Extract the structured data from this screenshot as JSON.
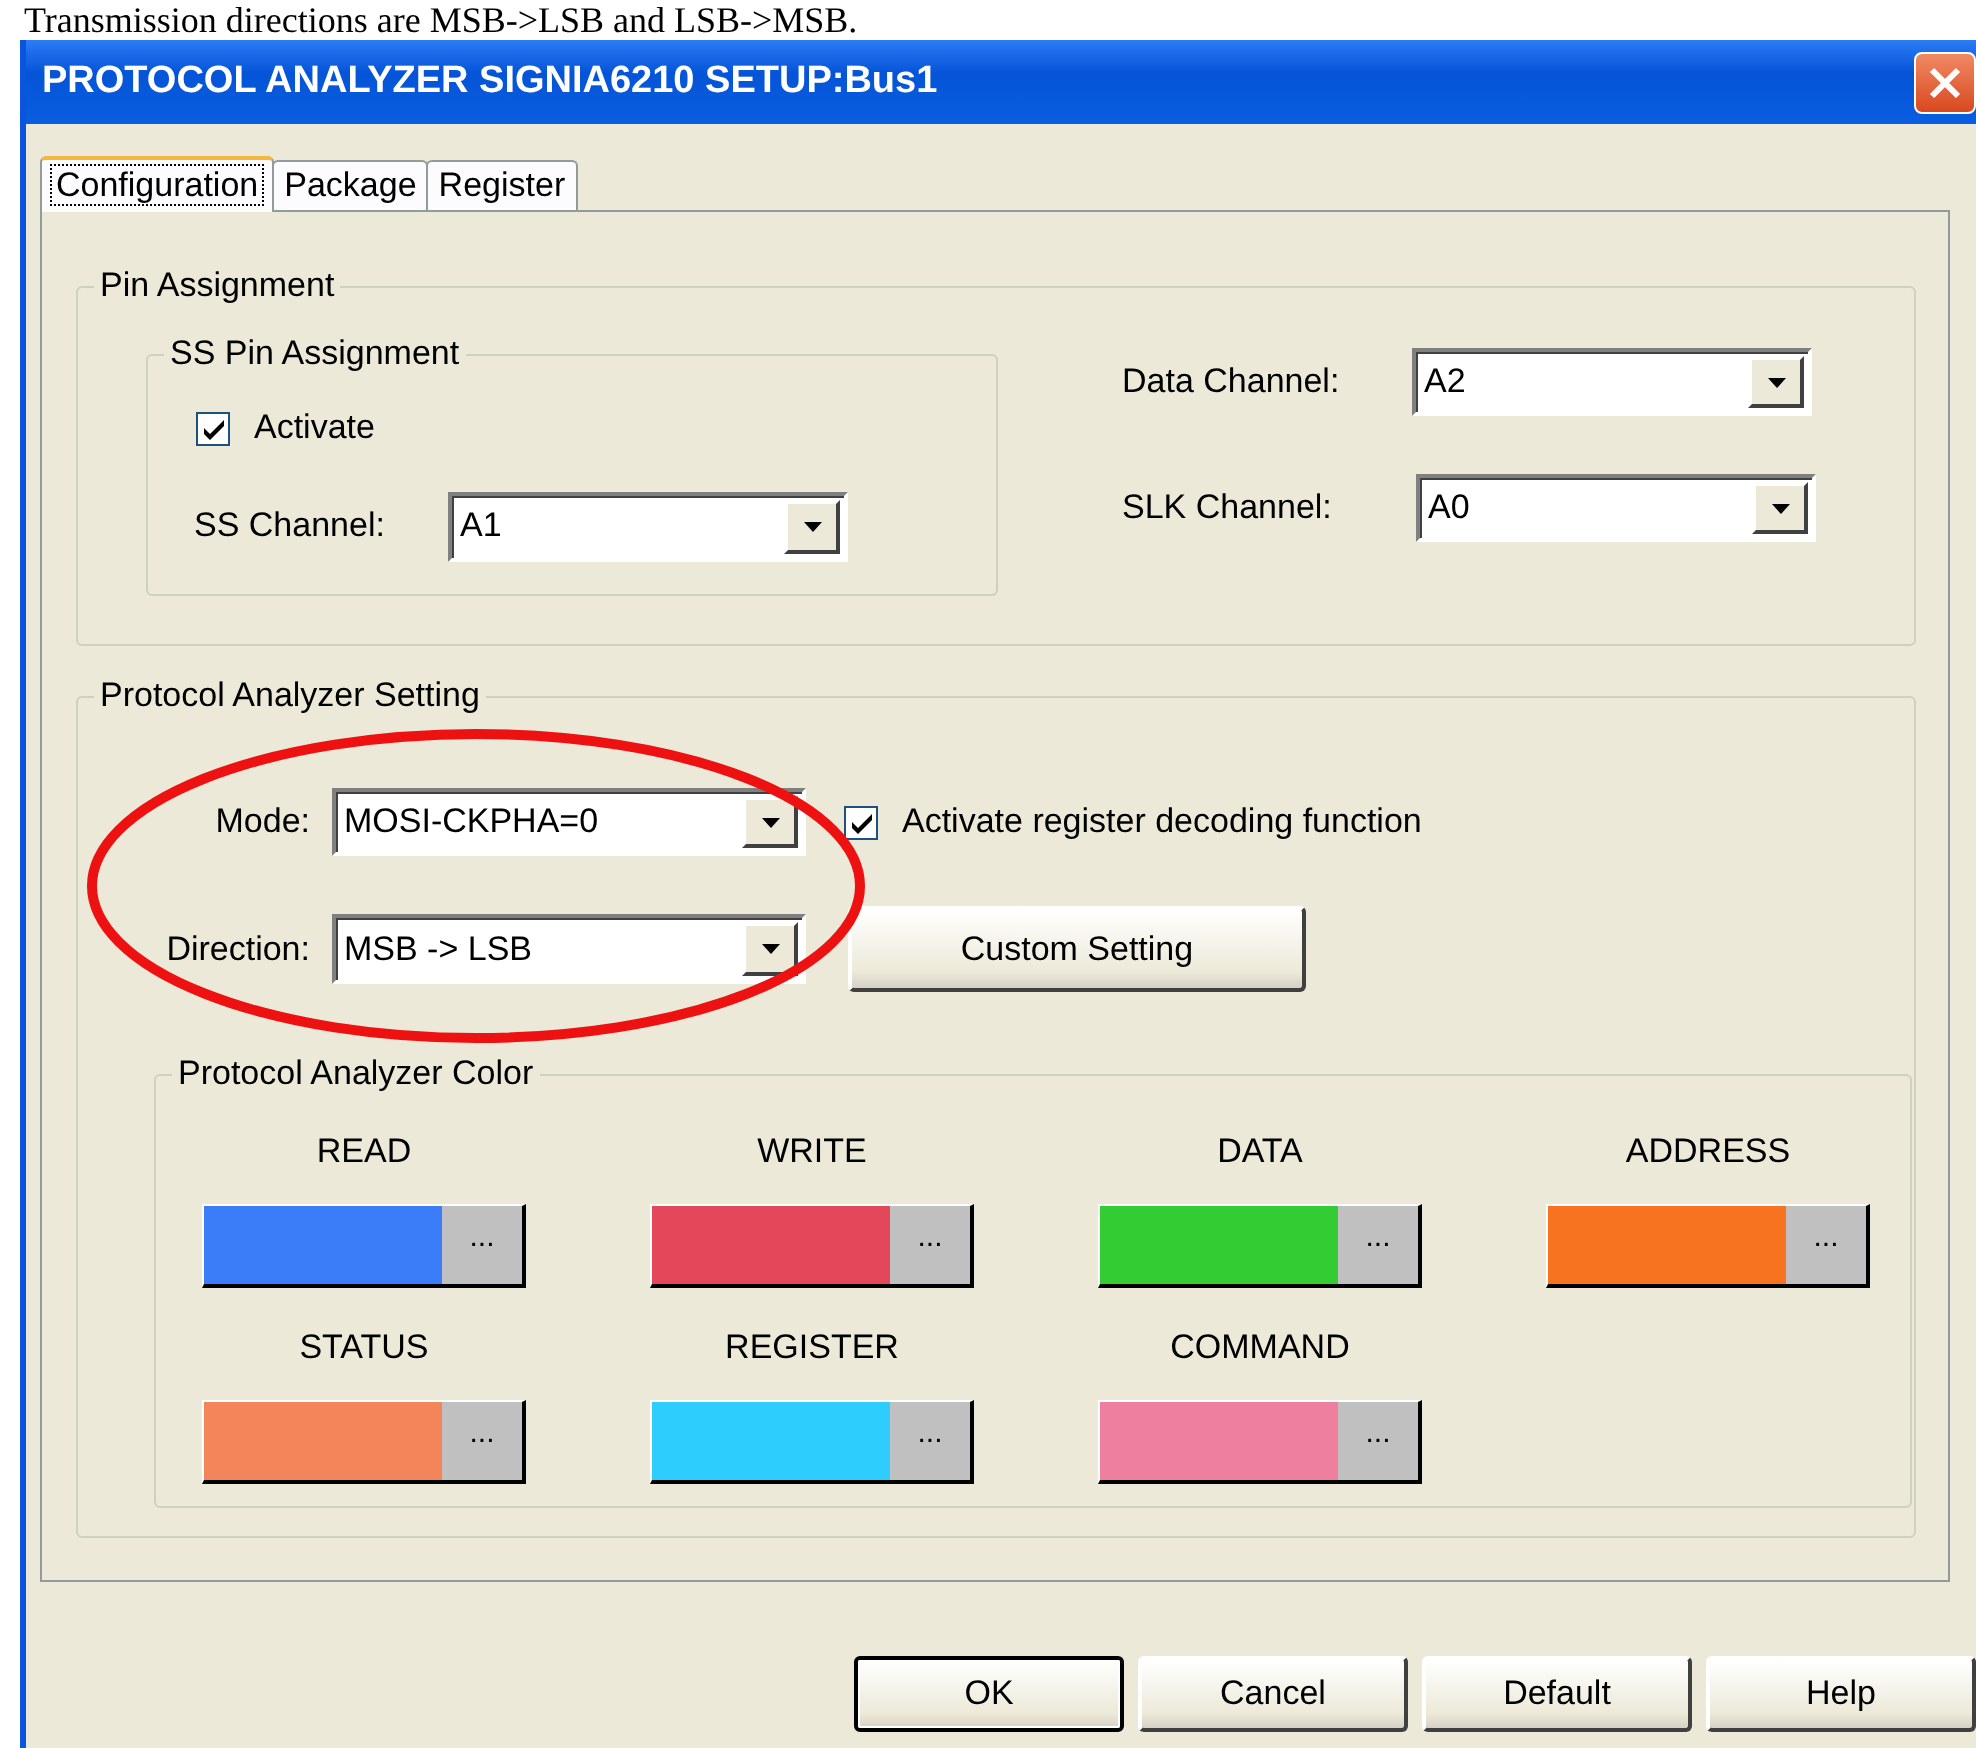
{
  "document_text": "Transmission directions are MSB->LSB and LSB->MSB.",
  "window": {
    "title": "PROTOCOL ANALYZER SIGNIA6210 SETUP:Bus1"
  },
  "tabs": [
    {
      "label": "Configuration",
      "selected": true
    },
    {
      "label": "Package",
      "selected": false
    },
    {
      "label": "Register",
      "selected": false
    }
  ],
  "pin_assignment": {
    "title": "Pin Assignment",
    "ss_pin_assignment": {
      "title": "SS Pin Assignment",
      "activate": {
        "label": "Activate",
        "checked": true
      },
      "ss_channel": {
        "label": "SS Channel:",
        "value": "A1"
      }
    },
    "data_channel": {
      "label": "Data Channel:",
      "value": "A2"
    },
    "slk_channel": {
      "label": "SLK Channel:",
      "value": "A0"
    }
  },
  "protocol_analyzer_setting": {
    "title": "Protocol Analyzer Setting",
    "mode": {
      "label": "Mode:",
      "value": "MOSI-CKPHA=0"
    },
    "register_decoding": {
      "label": "Activate register decoding function",
      "checked": true
    },
    "direction": {
      "label": "Direction:",
      "value": "MSB -> LSB"
    },
    "custom_setting_button": "Custom Setting",
    "color_group": {
      "title": "Protocol Analyzer Color",
      "items": [
        {
          "label": "READ",
          "color": "#3b7cf9",
          "picker_button": "..."
        },
        {
          "label": "WRITE",
          "color": "#e2485a",
          "picker_button": "..."
        },
        {
          "label": "DATA",
          "color": "#33cc33",
          "picker_button": "..."
        },
        {
          "label": "ADDRESS",
          "color": "#f7731f",
          "picker_button": "..."
        },
        {
          "label": "STATUS",
          "color": "#f2855a",
          "picker_button": "..."
        },
        {
          "label": "REGISTER",
          "color": "#2dcdfd",
          "picker_button": "..."
        },
        {
          "label": "COMMAND",
          "color": "#ee7f9e",
          "picker_button": "..."
        }
      ]
    }
  },
  "buttons": [
    {
      "label": "OK",
      "default": true
    },
    {
      "label": "Cancel",
      "default": false
    },
    {
      "label": "Default",
      "default": false
    },
    {
      "label": "Help",
      "default": false
    }
  ]
}
